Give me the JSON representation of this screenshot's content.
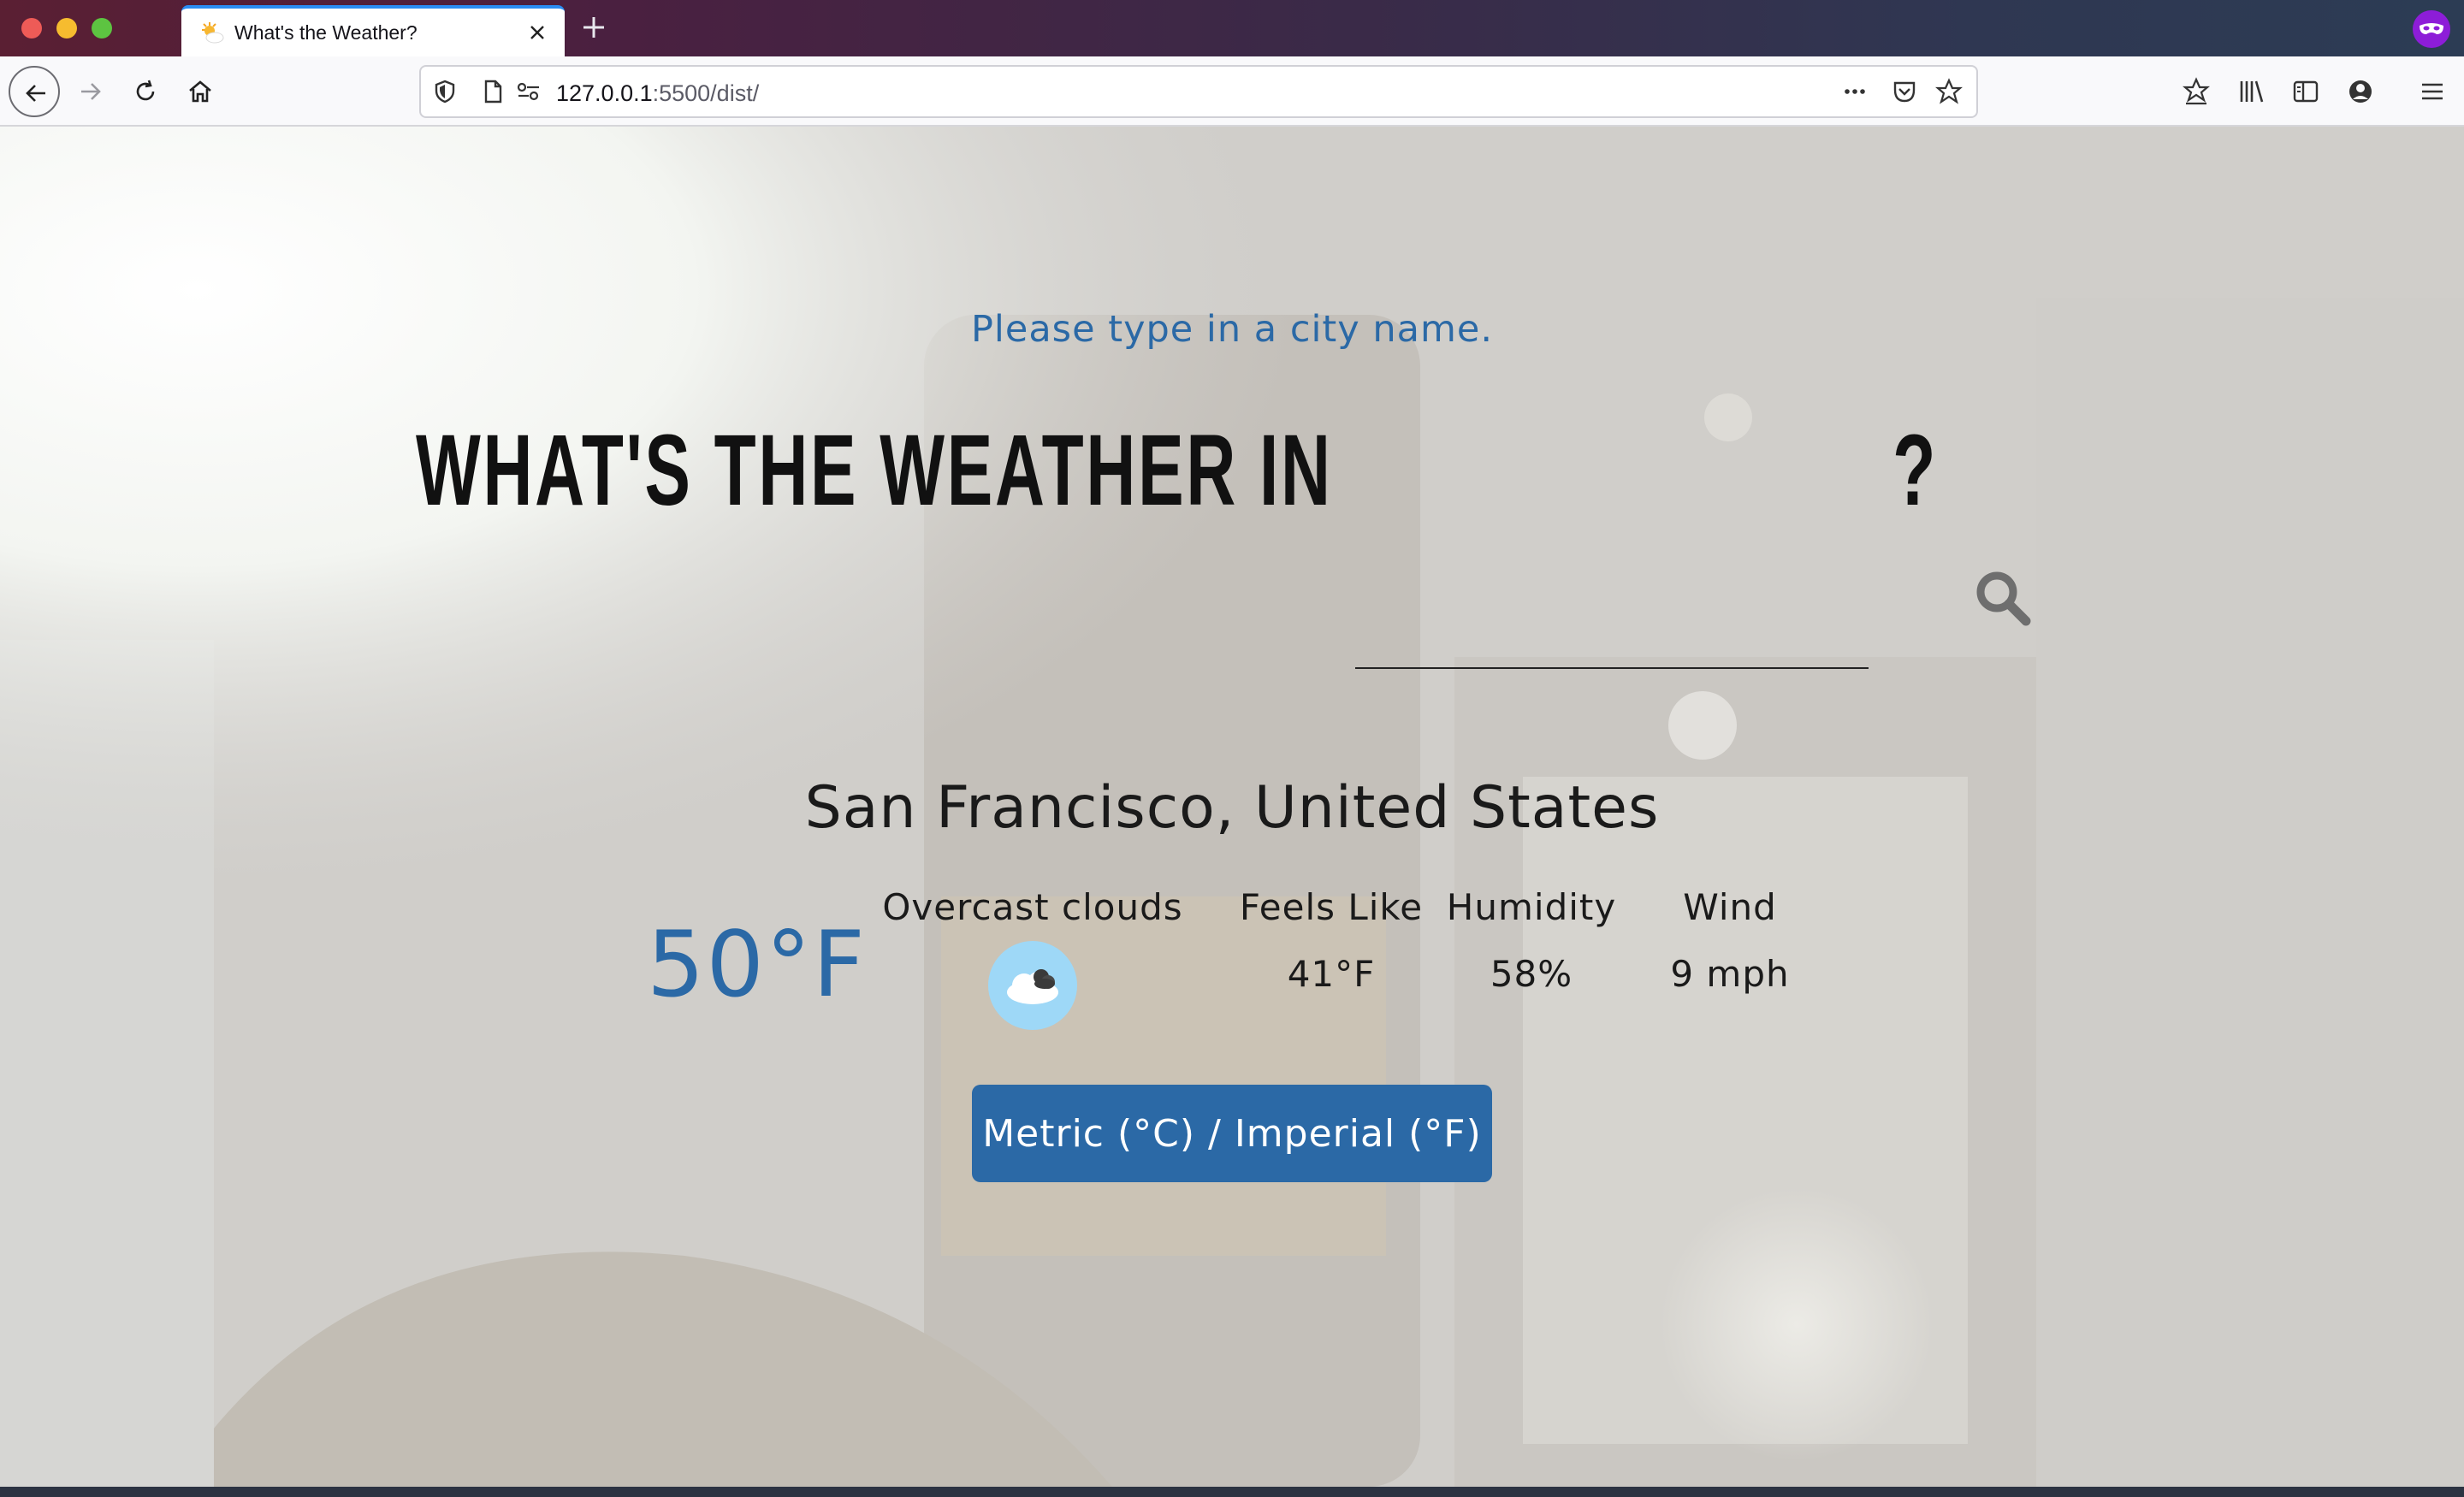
{
  "browser": {
    "tab_title": "What's the Weather?",
    "url_host": "127.0.0.1",
    "url_rest": ":5500/dist/",
    "icons": {
      "back": "back-arrow-icon",
      "forward": "forward-arrow-icon",
      "reload": "reload-icon",
      "home": "home-icon",
      "tracking": "shield-icon",
      "page": "page-icon",
      "permissions": "permissions-icon",
      "more": "more-icon",
      "pocket": "pocket-icon",
      "bookmark": "star-icon",
      "library": "library-icon",
      "sidebar": "sidebar-icon",
      "account": "account-icon",
      "menu": "hamburger-menu-icon"
    }
  },
  "page": {
    "prompt": "Please type in a city name.",
    "headline": "WHAT'S THE WEATHER IN",
    "question_mark": "?",
    "city_input_value": "",
    "location": "San Francisco, United States",
    "temperature": "50°F",
    "condition": "Overcast clouds",
    "condition_icon": "overcast-clouds-icon",
    "stats": [
      {
        "label": "Feels Like",
        "value": "41°F"
      },
      {
        "label": "Humidity",
        "value": "58%"
      },
      {
        "label": "Wind",
        "value": "9 mph"
      }
    ],
    "unit_toggle_label": "Metric (°C) / Imperial (°F)"
  },
  "colors": {
    "accent": "#2b69a6",
    "headline": "#111111",
    "tab_highlight": "#2a8cf2"
  }
}
